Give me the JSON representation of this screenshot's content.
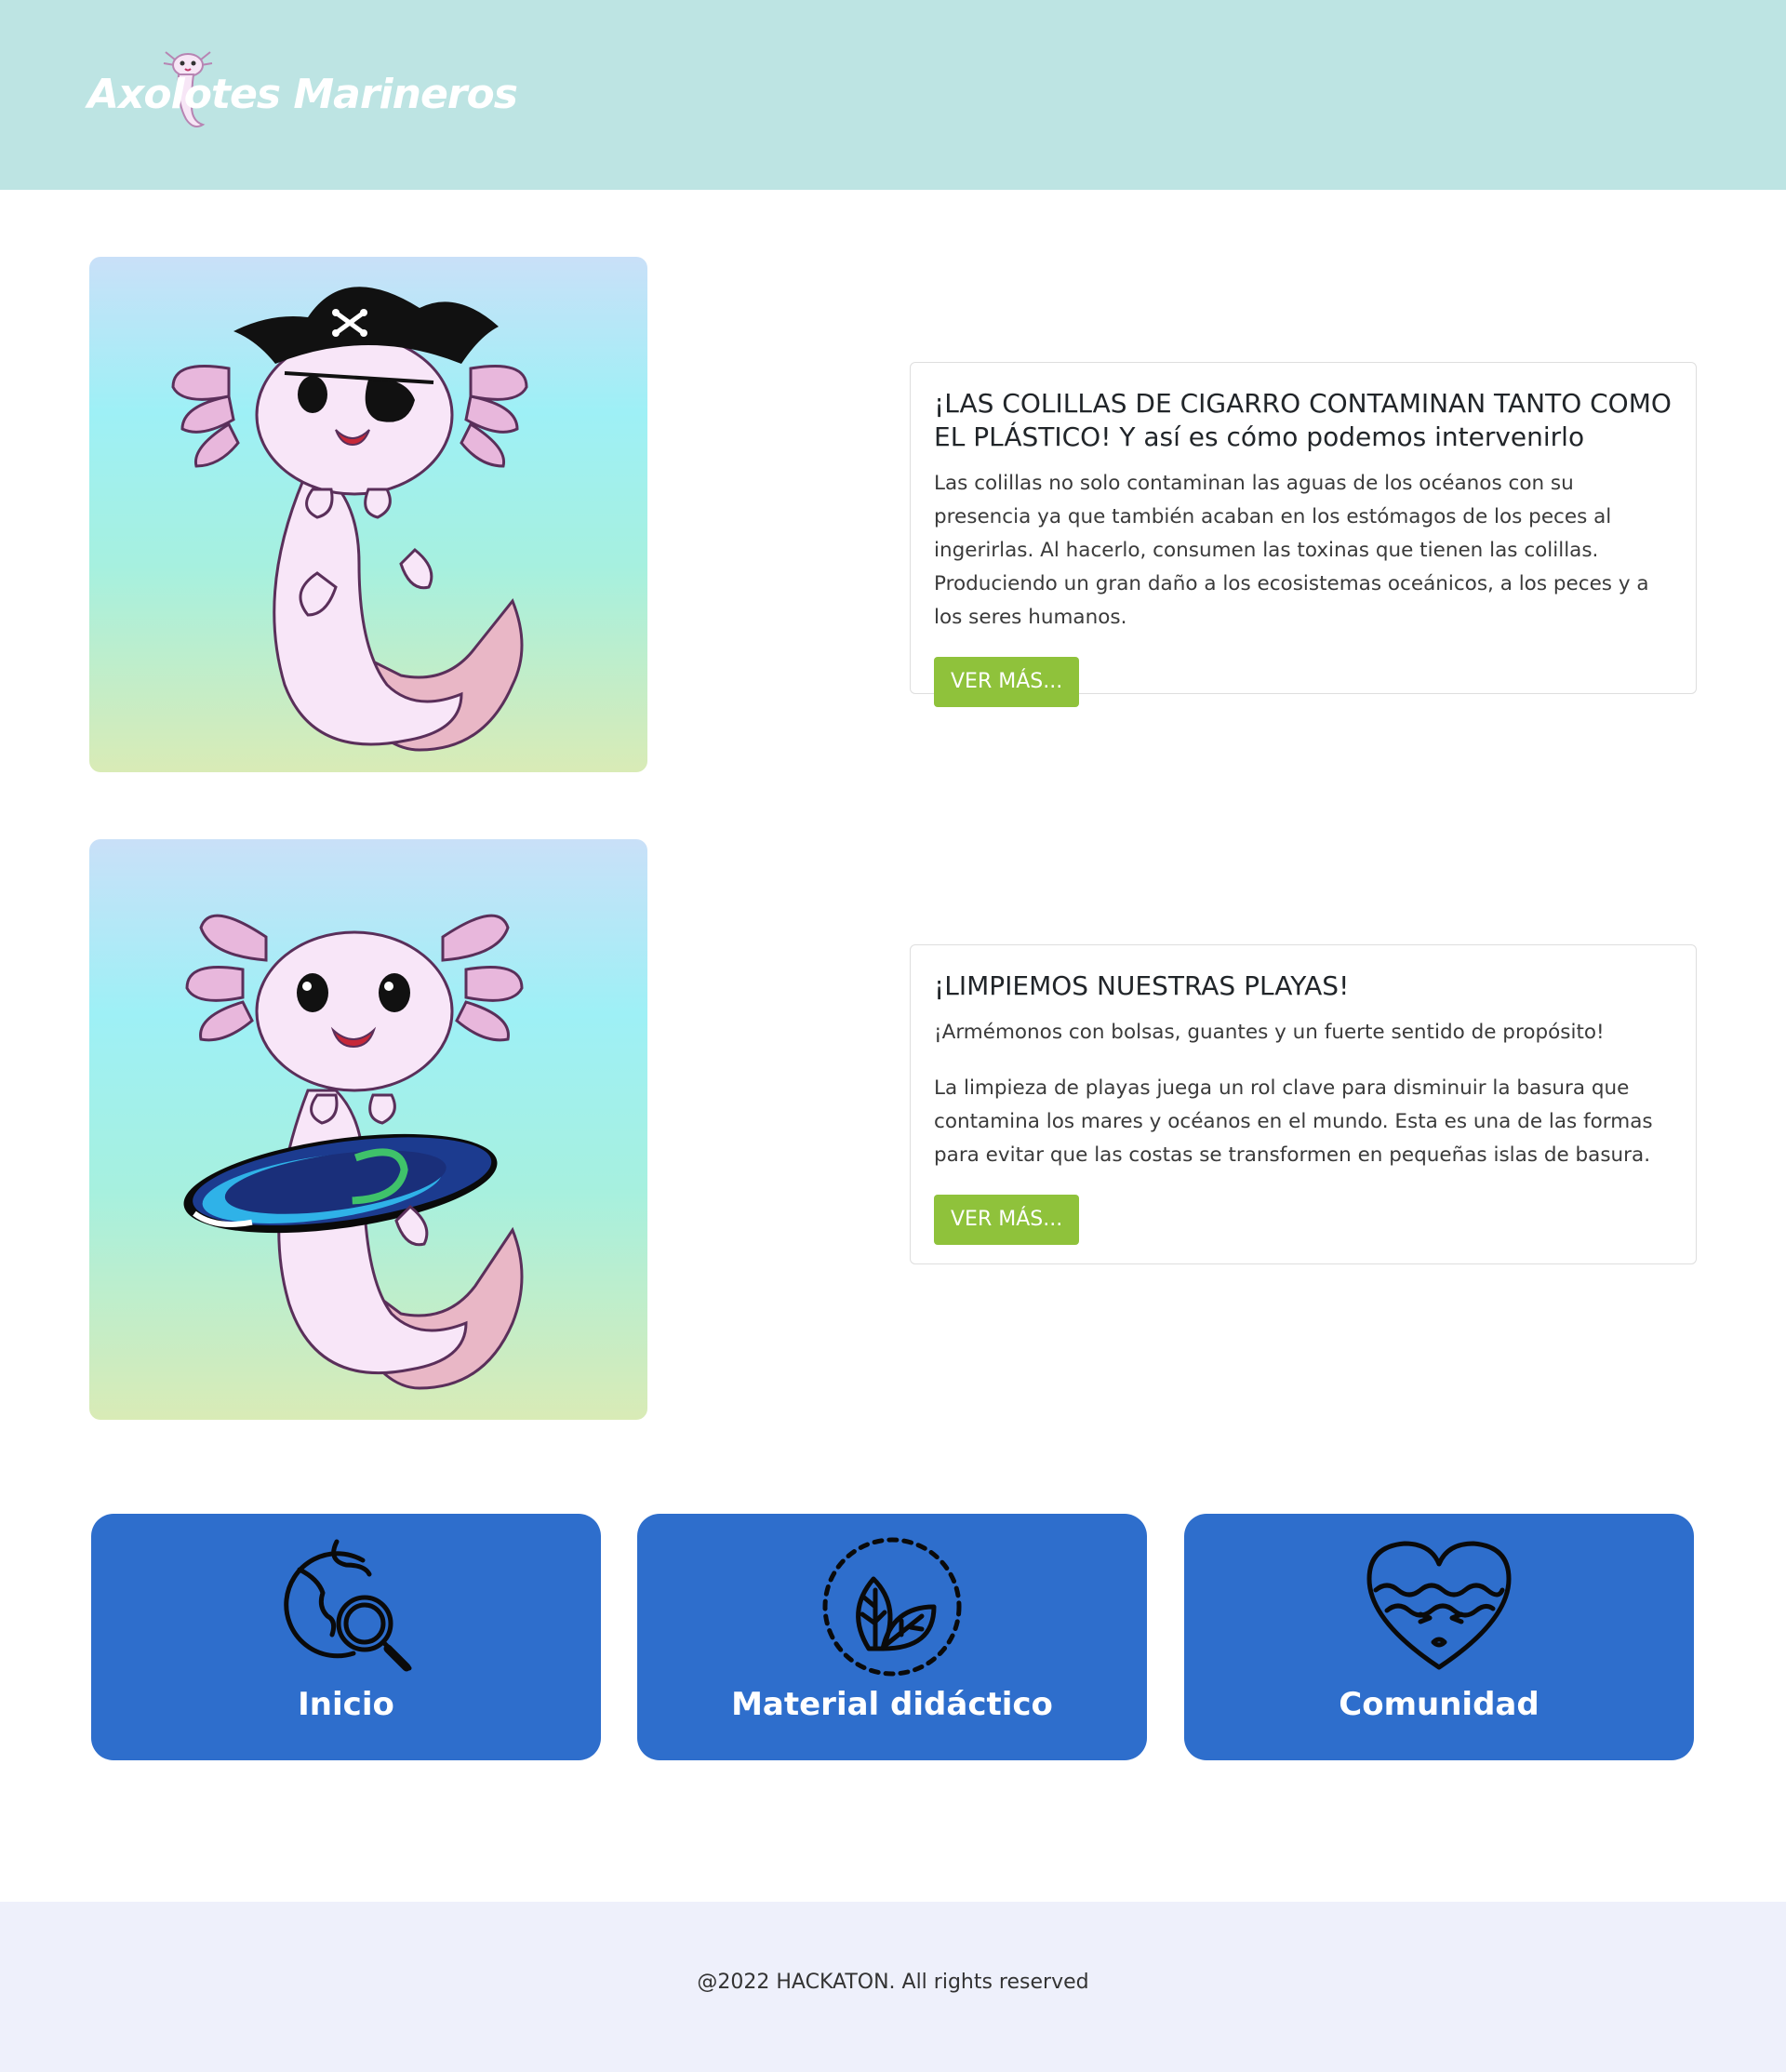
{
  "header": {
    "brand_title": "Axolotes Marineros"
  },
  "posts": [
    {
      "title": "¡LAS COLILLAS DE CIGARRO CONTAMINAN TANTO COMO EL PLÁSTICO! Y así es cómo podemos intervenirlo",
      "paragraphs": [
        "Las colillas no solo contaminan las aguas de los océanos con su presencia ya que también acaban en los estómagos de los peces al ingerirlas. Al hacerlo, consumen las toxinas que tienen las colillas. Produciendo un gran daño a los ecosistemas oceánicos, a los peces y a los seres humanos."
      ],
      "button_label": "VER MÁS..."
    },
    {
      "title": "¡LIMPIEMOS NUESTRAS PLAYAS!",
      "paragraphs": [
        "¡Armémonos con bolsas, guantes y un fuerte sentido de propósito!",
        "La limpieza de playas juega un rol clave para disminuir la basura que contamina los mares y océanos en el mundo. Esta es una de las formas para evitar que las costas se transformen en pequeñas islas de basura."
      ],
      "button_label": "VER MÁS..."
    }
  ],
  "nav_cards": [
    {
      "label": "Inicio",
      "icon": "globe-search-icon"
    },
    {
      "label": "Material didáctico",
      "icon": "leaves-circle-icon"
    },
    {
      "label": "Comunidad",
      "icon": "heart-waves-icon"
    }
  ],
  "footer": {
    "text": "@2022 HACKATON. All rights reserved"
  },
  "colors": {
    "header_bg": "#bde4e3",
    "button_green": "#8fc23b",
    "nav_blue": "#2e6ecc",
    "footer_bg": "#eef0fb"
  }
}
